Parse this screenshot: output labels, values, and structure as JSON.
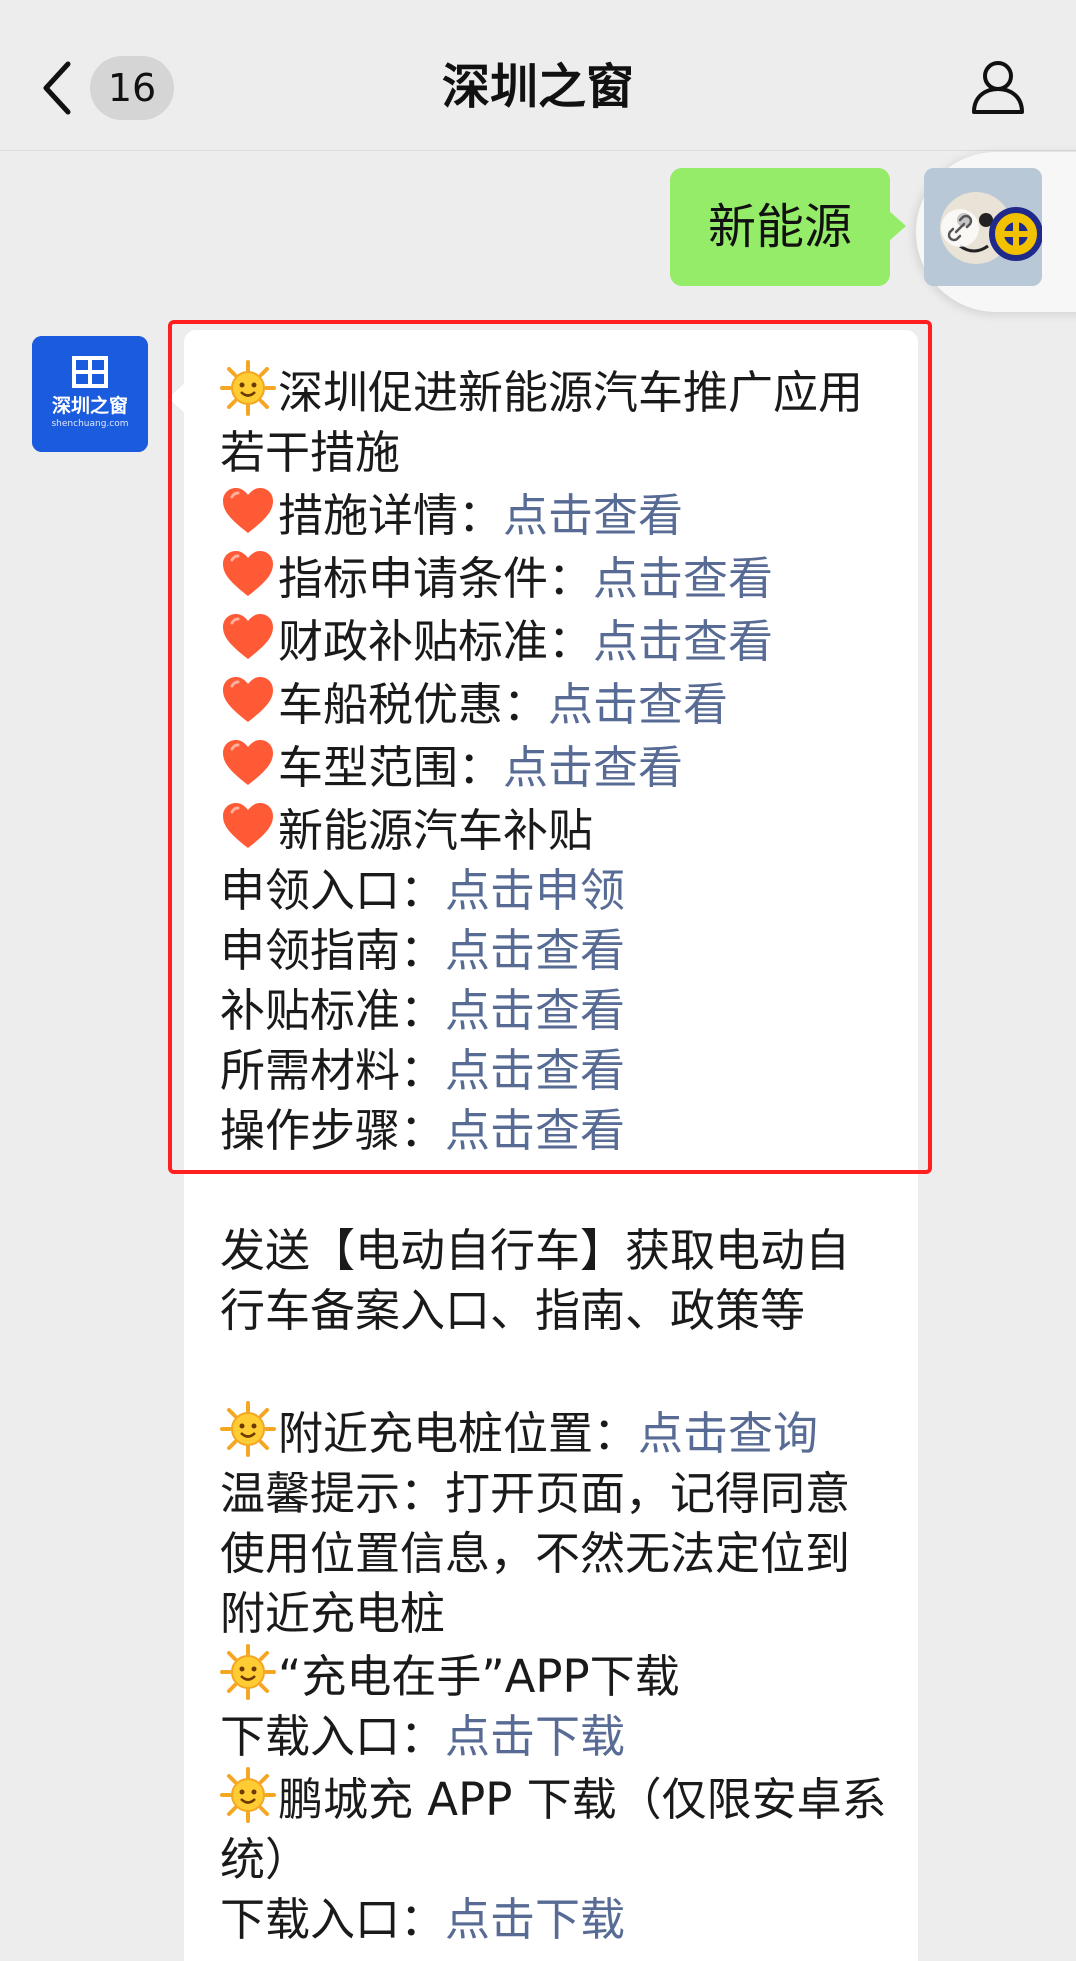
{
  "header": {
    "title": "深圳之窗",
    "unread_count": "16"
  },
  "my_message": {
    "text": "新能源"
  },
  "official_account": {
    "avatar_brand": "深圳之窗",
    "avatar_domain": "shenchuang.com"
  },
  "reply": {
    "block1": {
      "headline": "深圳促进新能源汽车推广应用若干措施",
      "items": [
        {
          "label": "措施详情：",
          "link": "点击查看"
        },
        {
          "label": "指标申请条件：",
          "link": "点击查看"
        },
        {
          "label": "财政补贴标准：",
          "link": "点击查看"
        },
        {
          "label": "车船税优惠：",
          "link": "点击查看"
        },
        {
          "label": "车型范围：",
          "link": "点击查看"
        }
      ],
      "subsidy_heading": "新能源汽车补贴",
      "subsidy_items": [
        {
          "label": "申领入口：",
          "link": "点击申领"
        },
        {
          "label": "申领指南：",
          "link": "点击查看"
        },
        {
          "label": "补贴标准：",
          "link": "点击查看"
        },
        {
          "label": "所需材料：",
          "link": "点击查看"
        },
        {
          "label": "操作步骤：",
          "link": "点击查看"
        }
      ]
    },
    "block2": {
      "ebike_text": "发送【电动自行车】获取电动自行车备案入口、指南、政策等",
      "charging_label": "附近充电桩位置：",
      "charging_link": "点击查询",
      "tip": "温馨提示：打开页面，记得同意使用位置信息，不然无法定位到附近充电桩",
      "app1_title": "“充电在手”APP下载",
      "app1_label": "下载入口：",
      "app1_link": "点击下载",
      "app2_title": "鹏城充 APP 下载（仅限安卓系统）",
      "app2_label": "下载入口：",
      "app2_link": "点击下载"
    }
  },
  "colors": {
    "link": "#576b95",
    "my_bubble": "#95ec69",
    "highlight": "#ff1f1f",
    "oa_brand": "#1b5bde"
  },
  "icons": [
    "back-chevron-icon",
    "profile-icon",
    "sun-emoji-icon",
    "heart-emoji-icon",
    "link-icon"
  ]
}
